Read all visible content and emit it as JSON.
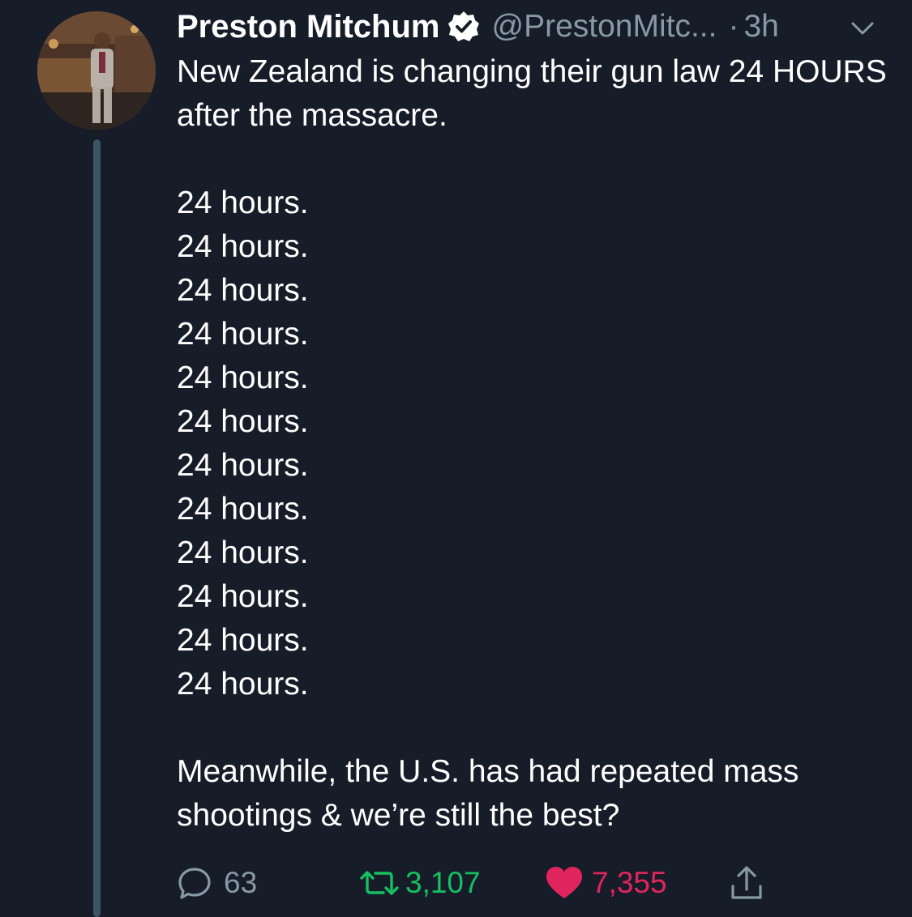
{
  "tweet": {
    "author_name": "Preston Mitchum",
    "handle": "@PrestonMitc...",
    "separator": "·",
    "time": "3h",
    "body_intro": "New Zealand is changing their gun law 24 HOURS after the massacre.",
    "repeated_lines": [
      "24 hours.",
      "24 hours.",
      "24 hours.",
      "24 hours.",
      "24 hours.",
      "24 hours.",
      "24 hours.",
      "24 hours.",
      "24 hours.",
      "24 hours.",
      "24 hours.",
      "24 hours."
    ],
    "body_outro": "Meanwhile, the U.S. has had repeated mass shootings & we’re still the best?",
    "stats": {
      "replies": "63",
      "retweets": "3,107",
      "likes": "7,355"
    }
  },
  "icons": {
    "verified": "verified-badge-icon",
    "caret": "chevron-down-icon",
    "reply": "speech-bubble-icon",
    "retweet": "retweet-arrows-icon",
    "like": "heart-icon",
    "share": "share-upload-icon"
  },
  "colors": {
    "background": "#161d28",
    "text_primary": "#ffffff",
    "text_secondary": "#8899a6",
    "retweet_active": "#17bf63",
    "like_active": "#e0245e",
    "thread_line": "#3d5466"
  }
}
